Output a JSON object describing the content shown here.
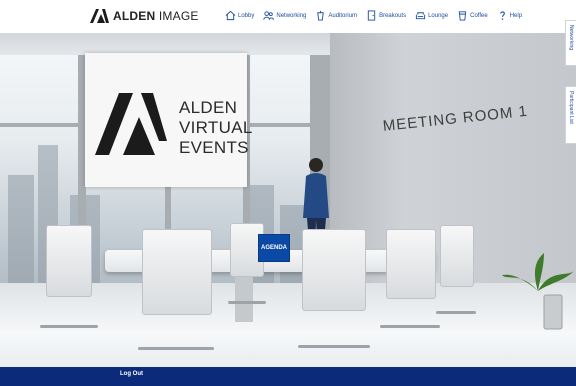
{
  "header": {
    "brand": {
      "bold": "ALDEN",
      "light": "IMAGE"
    },
    "nav": [
      {
        "label": "Lobby",
        "icon": "house-icon"
      },
      {
        "label": "Networking",
        "icon": "people-icon"
      },
      {
        "label": "Auditorium",
        "icon": "podium-icon"
      },
      {
        "label": "Breakouts",
        "icon": "door-icon"
      },
      {
        "label": "Lounge",
        "icon": "sofa-icon"
      },
      {
        "label": "Coffee",
        "icon": "cup-icon"
      },
      {
        "label": "Help",
        "icon": "help-icon"
      }
    ]
  },
  "scene": {
    "sign": {
      "line1": "ALDEN",
      "line2": "VIRTUAL",
      "line3": "EVENTS"
    },
    "room_label": "MEETING ROOM 1",
    "agenda_label": "AGENDA"
  },
  "side_tabs": [
    {
      "label": "Networking"
    },
    {
      "label": "Participant List"
    }
  ],
  "footer": {
    "logout": "Log Out"
  },
  "colors": {
    "accent": "#1f4fa0",
    "footer": "#0b2a7a",
    "agenda": "#0b49a6"
  }
}
